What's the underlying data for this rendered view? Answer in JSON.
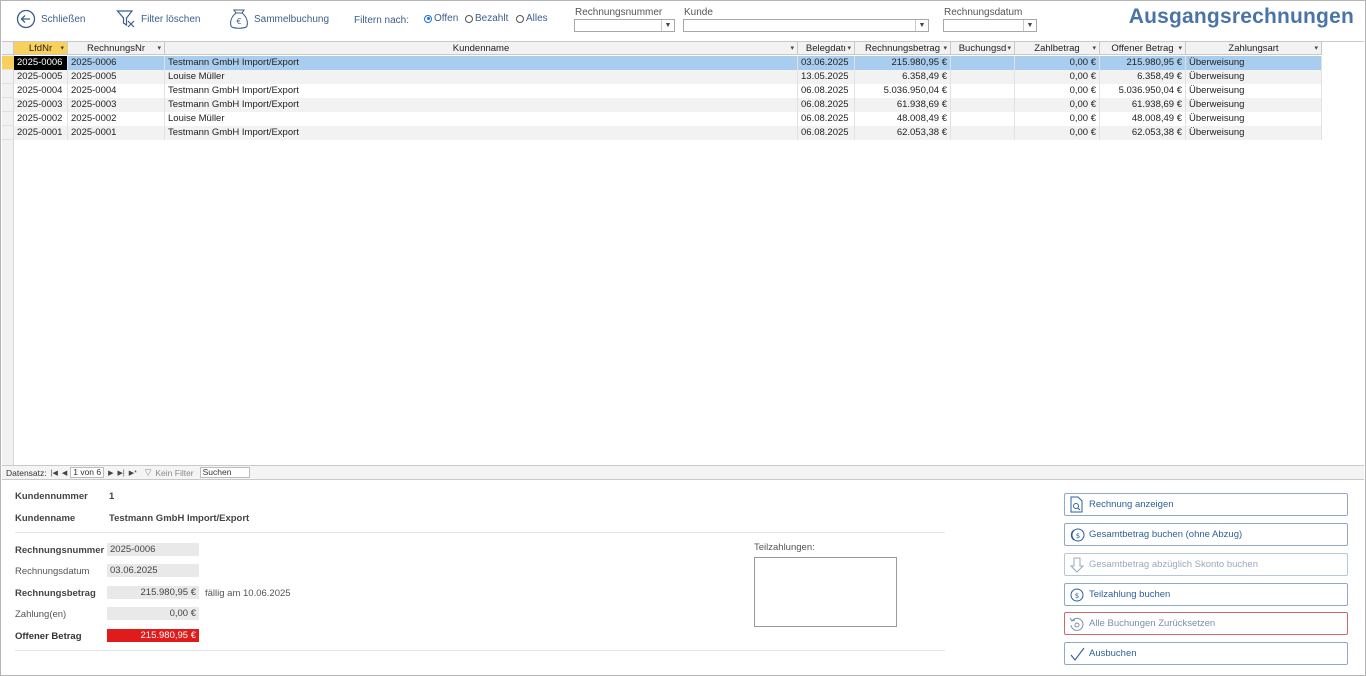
{
  "toolbar": {
    "close_label": "Schließen",
    "clear_filter_label": "Filter löschen",
    "batch_label": "Sammelbuchung",
    "filter_by_label": "Filtern nach:",
    "radio_open": "Offen",
    "radio_paid": "Bezahlt",
    "radio_all": "Alles",
    "invoice_number_label": "Rechnungsnummer",
    "customer_label": "Kunde",
    "invoice_date_label": "Rechnungsdatum",
    "selected_filter": "Offen"
  },
  "page_title": "Ausgangsrechnungen",
  "grid": {
    "columns": [
      "LfdNr",
      "RechnungsNr",
      "Kundenname",
      "Belegdatı",
      "Rechnungsbetrag",
      "Buchungsd",
      "Zahlbetrag",
      "Offener Betrag",
      "Zahlungsart"
    ],
    "rows": [
      {
        "lfd": "2025-0006",
        "nr": "2025-0006",
        "kunde": "Testmann GmbH Import/Export",
        "datum": "03.06.2025",
        "betrag": "215.980,95 €",
        "buchung": "",
        "zahl": "0,00 €",
        "offen": "215.980,95 €",
        "art": "Überweisung"
      },
      {
        "lfd": "2025-0005",
        "nr": "2025-0005",
        "kunde": "Louise Müller",
        "datum": "13.05.2025",
        "betrag": "6.358,49 €",
        "buchung": "",
        "zahl": "0,00 €",
        "offen": "6.358,49 €",
        "art": "Überweisung"
      },
      {
        "lfd": "2025-0004",
        "nr": "2025-0004",
        "kunde": "Testmann GmbH Import/Export",
        "datum": "06.08.2025",
        "betrag": "5.036.950,04 €",
        "buchung": "",
        "zahl": "0,00 €",
        "offen": "5.036.950,04 €",
        "art": "Überweisung"
      },
      {
        "lfd": "2025-0003",
        "nr": "2025-0003",
        "kunde": "Testmann GmbH Import/Export",
        "datum": "06.08.2025",
        "betrag": "61.938,69 €",
        "buchung": "",
        "zahl": "0,00 €",
        "offen": "61.938,69 €",
        "art": "Überweisung"
      },
      {
        "lfd": "2025-0002",
        "nr": "2025-0002",
        "kunde": "Louise Müller",
        "datum": "06.08.2025",
        "betrag": "48.008,49 €",
        "buchung": "",
        "zahl": "0,00 €",
        "offen": "48.008,49 €",
        "art": "Überweisung"
      },
      {
        "lfd": "2025-0001",
        "nr": "2025-0001",
        "kunde": "Testmann GmbH Import/Export",
        "datum": "06.08.2025",
        "betrag": "62.053,38 €",
        "buchung": "",
        "zahl": "0,00 €",
        "offen": "62.053,38 €",
        "art": "Überweisung"
      }
    ]
  },
  "nav": {
    "record_label": "Datensatz:",
    "position": "1 von 6",
    "filter_state": "Kein Filter",
    "search_placeholder": "Suchen"
  },
  "detail": {
    "customer_number_label": "Kundennummer",
    "customer_number": "1",
    "customer_name_label": "Kundenname",
    "customer_name": "Testmann GmbH Import/Export",
    "invoice_number_label": "Rechnungsnummer",
    "invoice_number": "2025-0006",
    "invoice_date_label": "Rechnungsdatum",
    "invoice_date": "03.06.2025",
    "invoice_amount_label": "Rechnungsbetrag",
    "invoice_amount": "215.980,95 €",
    "due_text": "fällig am 10.06.2025",
    "payments_label": "Zahlung(en)",
    "payments": "0,00 €",
    "open_amount_label": "Offener Betrag",
    "open_amount": "215.980,95 €",
    "partial_label": "Teilzahlungen:"
  },
  "actions": {
    "show_invoice": "Rechnung anzeigen",
    "book_total": "Gesamtbetrag buchen (ohne Abzug)",
    "book_skonto": "Gesamtbetrag abzüglich Skonto buchen",
    "book_partial": "Teilzahlung buchen",
    "reset_all": "Alle Buchungen Zurücksetzen",
    "settle": "Ausbuchen"
  },
  "colors": {
    "title": "#4a74a8",
    "selected_row": "#a9cdee",
    "open_amount_bg": "#e01b1b",
    "selected_header": "#f9d05c"
  }
}
